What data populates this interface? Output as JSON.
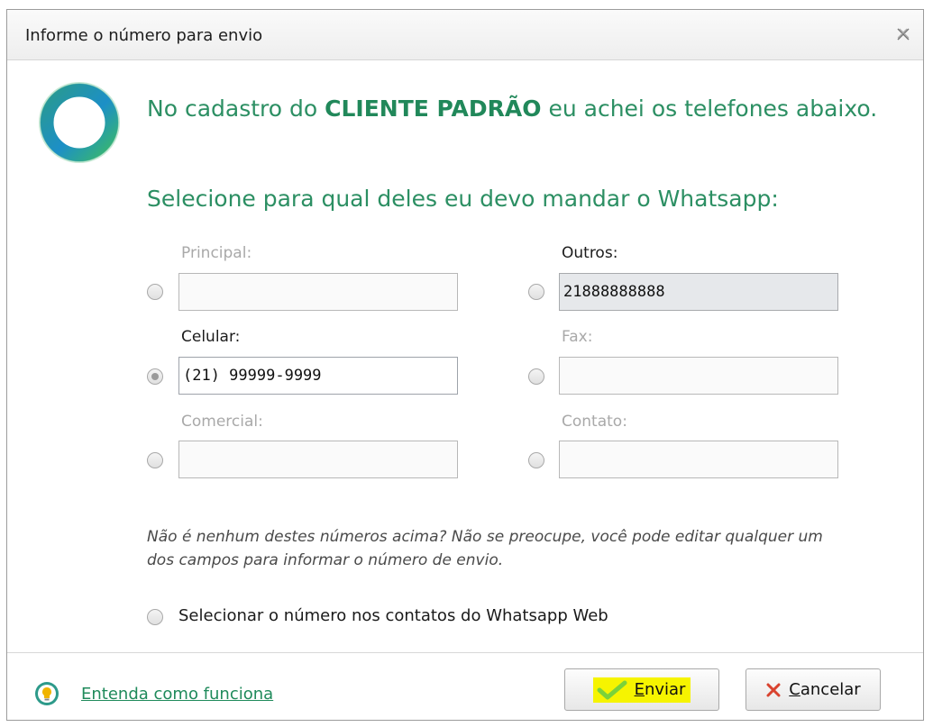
{
  "dialog": {
    "title": "Informe o número para envio"
  },
  "headline": {
    "prefix": "No cadastro do ",
    "client": "CLIENTE PADRÃO",
    "suffix": " eu achei os telefones abaixo."
  },
  "subheadline": "Selecione para qual deles eu devo mandar o Whatsapp:",
  "fields": {
    "principal": {
      "label": "Principal:",
      "value": "",
      "selected": false
    },
    "outros": {
      "label": "Outros:",
      "value": "21888888888",
      "selected": false
    },
    "celular": {
      "label": "Celular:",
      "value": "(21) 99999-9999",
      "selected": true
    },
    "fax": {
      "label": "Fax:",
      "value": "",
      "selected": false
    },
    "comercial": {
      "label": "Comercial:",
      "value": "",
      "selected": false
    },
    "contato": {
      "label": "Contato:",
      "value": "",
      "selected": false
    }
  },
  "hint": "Não é nenhum destes números acima? Não se preocupe, você pode editar qualquer um dos campos para informar o número de envio.",
  "whatsapp_option": {
    "label": "Selecionar o número nos contatos do Whatsapp Web",
    "selected": false
  },
  "footer": {
    "help_link": "Entenda como funciona",
    "send_accel": "E",
    "send_rest": "nviar",
    "cancel_accel": "C",
    "cancel_rest": "ancelar"
  },
  "colors": {
    "accent": "#2c8f63",
    "highlight": "#f6f400",
    "cancel_x": "#d9432f"
  },
  "icons": [
    "close-icon",
    "app-logo-icon",
    "lightbulb-help-icon",
    "checkmark-icon",
    "x-icon"
  ]
}
